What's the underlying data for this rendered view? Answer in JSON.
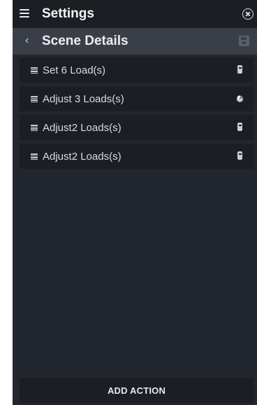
{
  "header": {
    "title": "Settings",
    "menu_icon": "hamburger-icon",
    "close_icon": "close-circle-icon"
  },
  "subheader": {
    "back_icon": "chevron-left-icon",
    "back_glyph": "‹",
    "title": "Scene Details",
    "save_icon": "save-icon"
  },
  "actions": [
    {
      "label": "Set 6 Load(s)",
      "icon": "load-device-icon"
    },
    {
      "label": "Adjust 3 Loads(s)",
      "icon": "shade-icon"
    },
    {
      "label": "Adjust2 Loads(s)",
      "icon": "load-device-icon"
    },
    {
      "label": "Adjust2 Loads(s)",
      "icon": "load-device-icon"
    }
  ],
  "footer": {
    "add_action_label": "ADD ACTION"
  },
  "colors": {
    "panel_bg": "#22262e",
    "topbar_bg": "#1b1e23",
    "subbar_bg": "#3a3f47",
    "row_bg": "#1b1e24",
    "text": "#d8dbe0"
  }
}
